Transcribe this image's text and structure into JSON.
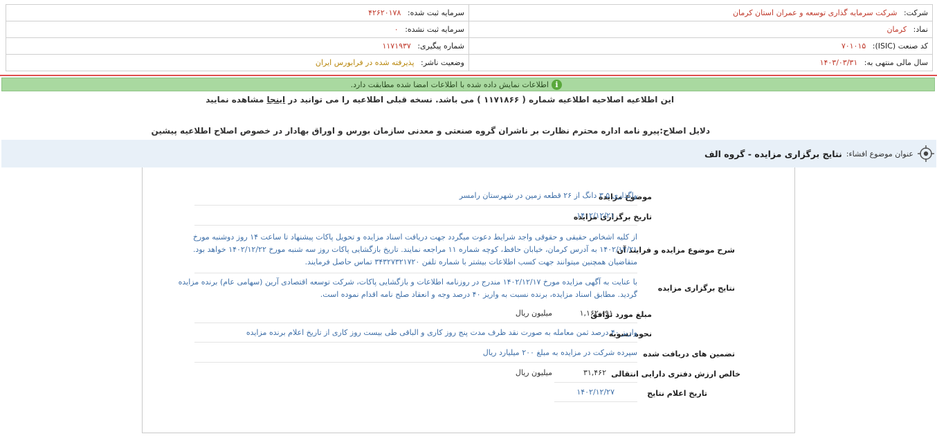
{
  "header": {
    "company_label": "شرکت:",
    "company_value": "شرکت سرمایه گذاری توسعه و عمران استان کرمان",
    "reg_capital_label": "سرمایه ثبت شده:",
    "reg_capital_value": "۴۲۶۲۰۱۷۸",
    "symbol_label": "نماد:",
    "symbol_value": "کرمان",
    "unreg_capital_label": "سرمایه ثبت نشده:",
    "unreg_capital_value": "۰",
    "isic_label": "کد صنعت (ISIC):",
    "isic_value": "۷۰۱۰۱۵",
    "tracking_label": "شماره پیگیری:",
    "tracking_value": "۱۱۷۱۹۳۷",
    "fiscal_label": "سال مالی منتهی به:",
    "fiscal_value": "۱۴۰۳/۰۳/۳۱",
    "status_label": "وضعیت ناشر:",
    "status_value": "پذیرفته شده در فرابورس ایران"
  },
  "banner": {
    "info_glyph": "i",
    "text": "اطلاعات نمایش داده شده با اطلاعات امضا شده مطابقت دارد."
  },
  "notice": {
    "part1": "این اطلاعیه اصلاحیه اطلاعیه شماره ( ۱۱۷۱۸۶۶ ) می باشد. نسخه قبلی اطلاعیه را می توانید در",
    "link": "اینجا",
    "part2": "مشاهده نمایید"
  },
  "reason": "دلایل اصلاح:پیرو نامه اداره محترم نظارت بر ناشران گروه صنعتی و معدنی سازمان بورس و اوراق بهادار در خصوص اصلاح اطلاعیه پیشین",
  "topic": {
    "label": "عنوان موضوع افشاء:",
    "title": "نتایج برگزاری مزایده - گروه الف"
  },
  "details": {
    "subject_label": "موضوع مزایده",
    "subject_value": "واگذاری ۳.۵ دانگ از ۲۶ قطعه زمین در شهرستان رامسر",
    "date_label": "تاریخ برگزاری مزایده",
    "date_value": "۱۴۰۲/۱۲/۲۱",
    "process_label": "شرح موضوع مزایده و فرایند آن",
    "process_value": "از کلیه اشخاص حقیقی و حقوقی واجد شرایط دعوت میگردد جهت دریافت اسناد مزایده و تحویل پاکات پیشنهاد تا ساعت ۱۴ روز دوشنبه مورخ ۱۴۰۲/۱۲/۲۱ به آدرس کرمان، خیابان حافظ، کوچه شماره ۱۱ مراجعه نمایند. تاریخ بازگشایی پاکات روز سه شنبه مورخ ۱۴۰۲/۱۲/۲۲ خواهد بود. متقاضیان همچنین میتوانند جهت کسب اطلاعات بیشتر با شماره تلفن ۳۴۳۲۷۳۲۱۷۲۰ تماس حاصل فرمایند.",
    "results_label": "نتایج برگزاری مزایده",
    "results_value": "با عنایت به آگهی مزایده مورخ ۱۴۰۲/۱۲/۱۷ مندرج در روزنامه اطلاعات و بازگشایی پاکات، شرکت توسعه اقتصادی آرین (سهامی عام) برنده مزایده گردید. مطابق اسناد مزایده، برنده نسبت به واریز ۴۰ درصد وجه و انعقاد صلح نامه اقدام نموده است.",
    "amount_label": "مبلغ مورد توافق",
    "amount_value": "۱,۱۶۲,۰۹۱",
    "amount_unit": "میلیون ریال",
    "settlement_label": "نحوه تسویه",
    "settlement_value": "واریز ۴۰ درصد ثمن معامله به صورت نقد ظرف مدت پنج روز کاری و الباقی طی بیست روز کاری از تاریخ اعلام برنده مزایده",
    "guarantee_label": "تضمین های دریافت شده",
    "guarantee_value": "سپرده شرکت در مزایده به مبلغ ۲۰۰ میلیارد ریال",
    "bookvalue_label": "خالص ارزش دفتری دارایی انتقالی",
    "bookvalue_value": "۳۱,۴۶۲",
    "bookvalue_unit": "میلیون ریال",
    "announce_label": "تاریخ اعلام نتایج",
    "announce_value": "۱۴۰۲/۱۲/۲۷"
  }
}
